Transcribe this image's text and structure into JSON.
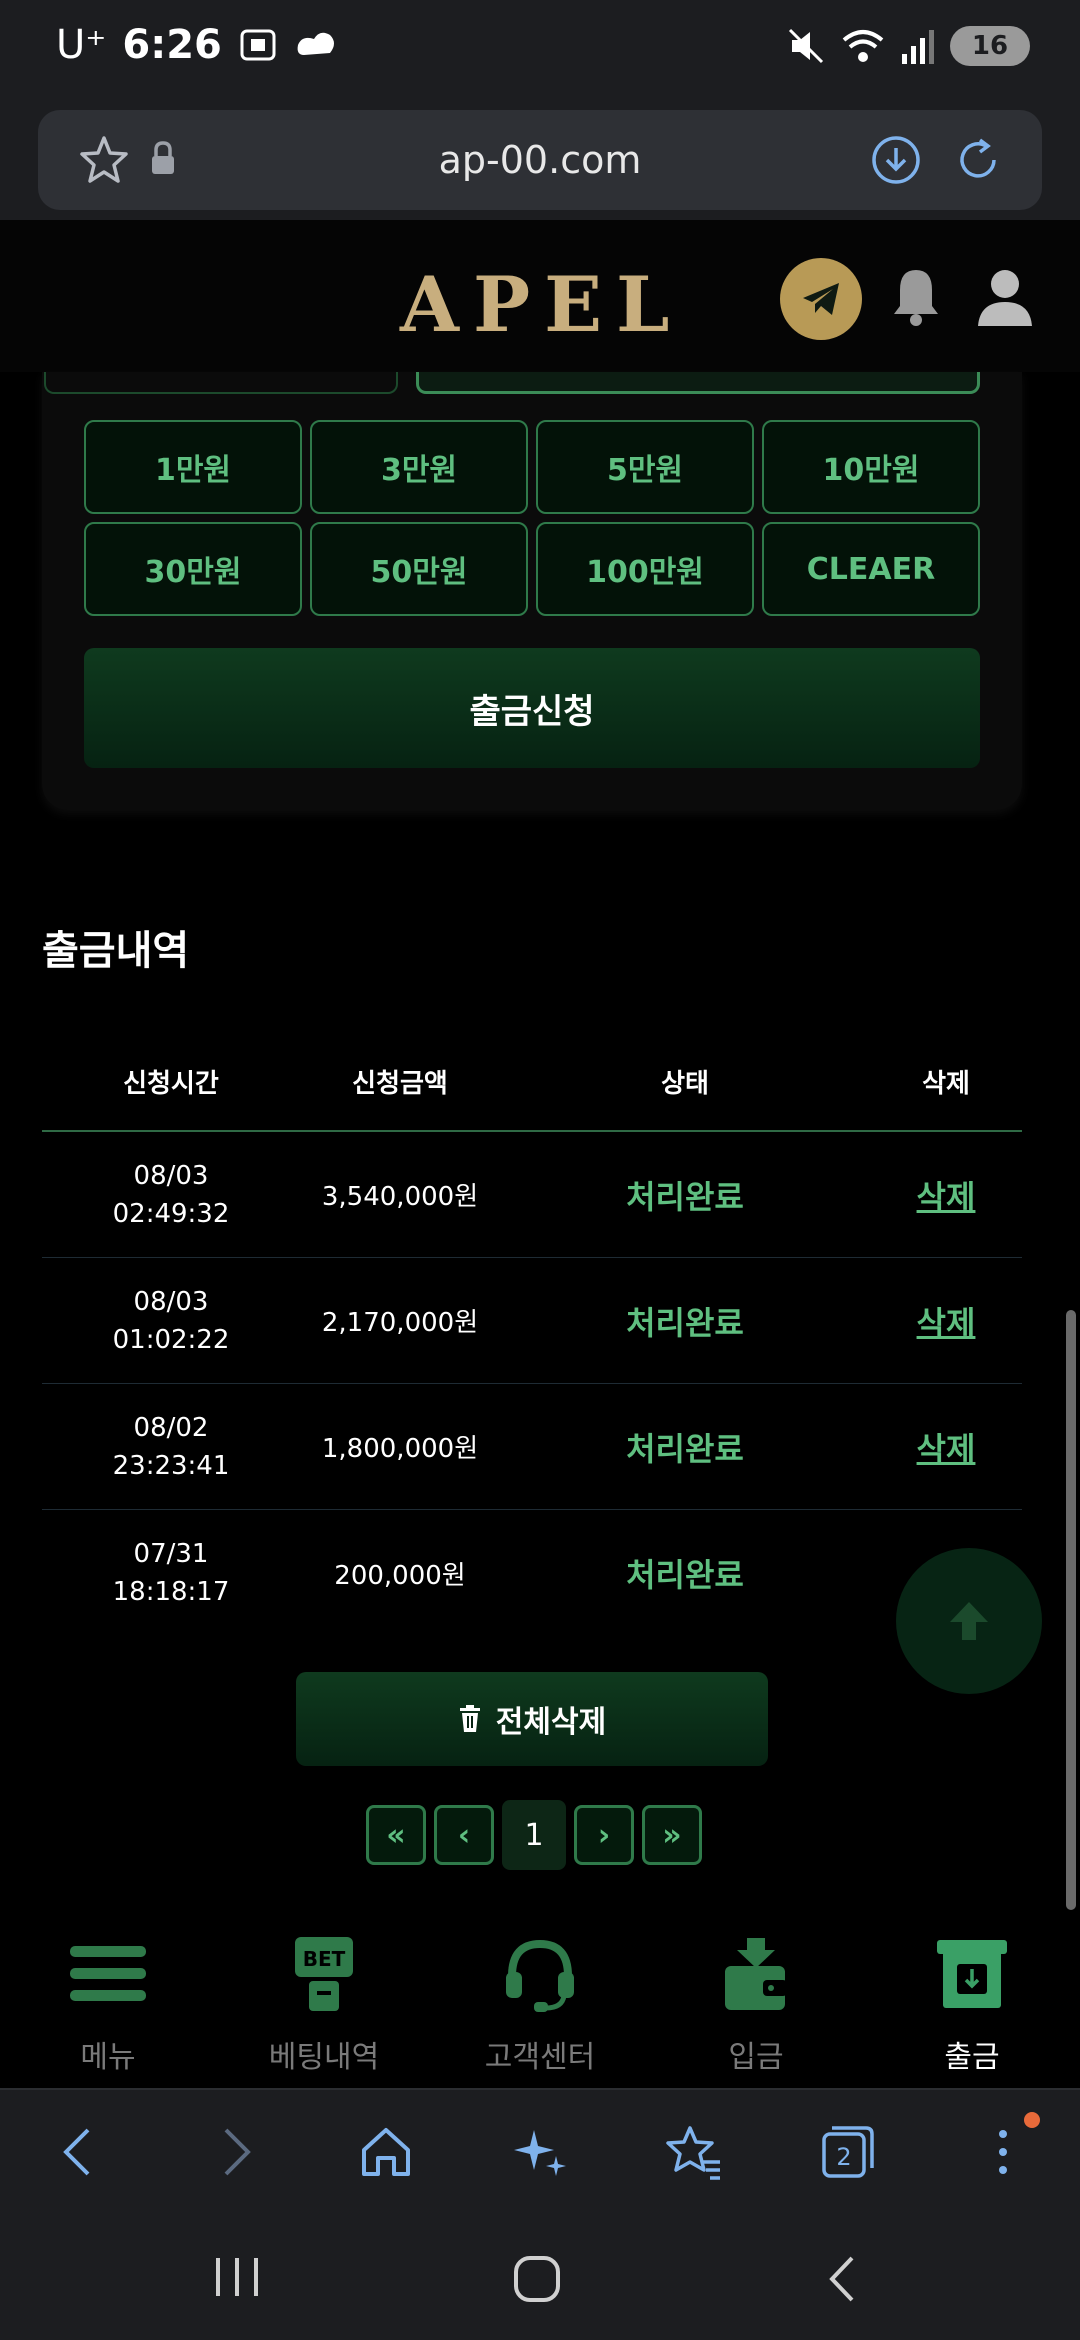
{
  "status_bar": {
    "carrier": "U⁺",
    "time": "6:26",
    "battery": "16"
  },
  "browser": {
    "url": "ap-00.com",
    "tab_count": "2"
  },
  "site": {
    "logo": "APEL"
  },
  "withdraw_form": {
    "amount_buttons": [
      "1만원",
      "3만원",
      "5만원",
      "10만원",
      "30만원",
      "50만원",
      "100만원",
      "CLEAER"
    ],
    "submit_label": "출금신청"
  },
  "history": {
    "title": "출금내역",
    "columns": [
      "신청시간",
      "신청금액",
      "상태",
      "삭제"
    ],
    "rows": [
      {
        "date": "08/03",
        "time": "02:49:32",
        "amount": "3,540,000원",
        "status": "처리완료",
        "delete": "삭제"
      },
      {
        "date": "08/03",
        "time": "01:02:22",
        "amount": "2,170,000원",
        "status": "처리완료",
        "delete": "삭제"
      },
      {
        "date": "08/02",
        "time": "23:23:41",
        "amount": "1,800,000원",
        "status": "처리완료",
        "delete": "삭제"
      },
      {
        "date": "07/31",
        "time": "18:18:17",
        "amount": "200,000원",
        "status": "처리완료",
        "delete": ""
      }
    ],
    "delete_all_label": "전체삭제",
    "pagination": {
      "first": "«",
      "prev": "‹",
      "current": "1",
      "next": "›",
      "last": "»"
    }
  },
  "bottom_nav": {
    "items": [
      {
        "label": "메뉴",
        "icon": "menu-icon"
      },
      {
        "label": "베팅내역",
        "icon": "bet-history-icon",
        "badge": "BET"
      },
      {
        "label": "고객센터",
        "icon": "headset-icon"
      },
      {
        "label": "입금",
        "icon": "wallet-deposit-icon"
      },
      {
        "label": "출금",
        "icon": "withdraw-icon"
      }
    ],
    "active": "출금"
  },
  "colors": {
    "accent_green": "#5fbf80",
    "border_green": "#2f7a4a",
    "logo_gold": "#c8ae7e",
    "background": "#000000"
  }
}
